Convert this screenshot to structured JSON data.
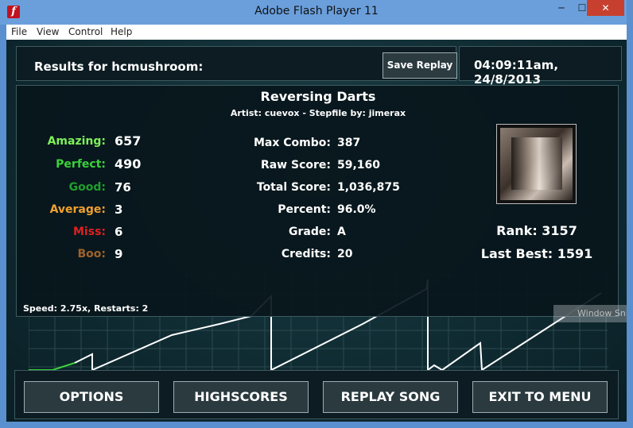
{
  "window": {
    "title": "Adobe Flash Player 11",
    "app_icon": "flash-icon",
    "min_glyph": "─",
    "max_glyph": "☐",
    "close_glyph": "✕",
    "close_color": "#c7402f"
  },
  "menu": {
    "items": [
      "File",
      "View",
      "Control",
      "Help"
    ]
  },
  "header": {
    "results_title": "Results for hcmushroom:",
    "save_replay_label": "Save Replay",
    "datetime": "04:09:11am, 24/8/2013"
  },
  "song": {
    "title": "Reversing Darts",
    "credit": "Artist: cuevox  -  Stepfile by: jimerax"
  },
  "judgements": [
    {
      "label": "Amazing:",
      "value": "657",
      "color": "#7ef05a"
    },
    {
      "label": "Perfect:",
      "value": "490",
      "color": "#3bd13b"
    },
    {
      "label": "Good:",
      "value": "76",
      "color": "#1f9e2c"
    },
    {
      "label": "Average:",
      "value": "3",
      "color": "#f0a030"
    },
    {
      "label": "Miss:",
      "value": "6",
      "color": "#e02020"
    },
    {
      "label": "Boo:",
      "value": "9",
      "color": "#a0622a"
    }
  ],
  "stats": [
    {
      "label": "Max Combo:",
      "value": "387"
    },
    {
      "label": "Raw Score:",
      "value": "59,160"
    },
    {
      "label": "Total Score:",
      "value": "1,036,875"
    },
    {
      "label": "Percent:",
      "value": "96.0%"
    },
    {
      "label": "Grade:",
      "value": "A"
    },
    {
      "label": "Credits:",
      "value": "20"
    }
  ],
  "speed_text": "Speed: 2.75x, Restarts: 2",
  "rank": {
    "rank_text": "Rank: 3157",
    "last_best_text": "Last Best: 1591"
  },
  "buttons": {
    "options": "OPTIONS",
    "highscores": "HIGHSCORES",
    "replay": "REPLAY SONG",
    "exit": "EXIT TO MENU"
  },
  "overlay": {
    "window_snip_label": "Window Snip"
  },
  "colors": {
    "stage_bg": "#0f2a31",
    "panel_border": "#3e5a60",
    "graph_line": "#ffffff",
    "graph_start": "#3bd13b",
    "miss_marker": "#5ac85a"
  }
}
